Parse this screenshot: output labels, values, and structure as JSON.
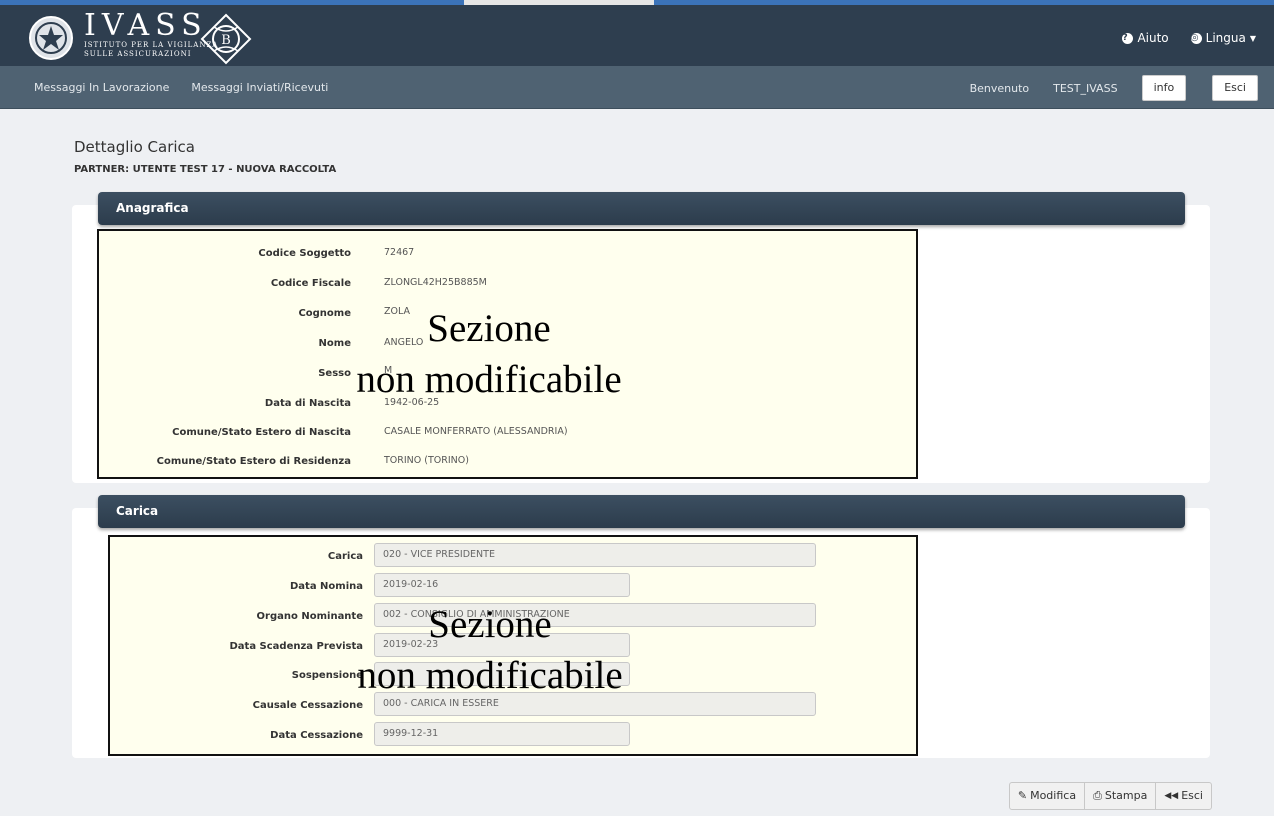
{
  "header": {
    "logo_title": "IVASS",
    "logo_line1": "ISTITUTO PER LA VIGILANZA",
    "logo_line2": "SULLE ASSICURAZIONI",
    "help_label": "Aiuto",
    "language_label": "Lingua"
  },
  "nav": {
    "items": [
      "Messaggi In Lavorazione",
      "Messaggi Inviati/Ricevuti"
    ],
    "welcome_label": "Benvenuto",
    "user": "TEST_IVASS",
    "info_label": "info",
    "exit_label": "Esci"
  },
  "page": {
    "title": "Dettaglio Carica",
    "subtitle": "PARTNER: UTENTE TEST 17 - NUOVA RACCOLTA"
  },
  "anagrafica": {
    "heading": "Anagrafica",
    "rows": [
      {
        "label": "Codice Soggetto",
        "value": "72467"
      },
      {
        "label": "Codice Fiscale",
        "value": "ZLONGL42H25B885M"
      },
      {
        "label": "Cognome",
        "value": "ZOLA"
      },
      {
        "label": "Nome",
        "value": "ANGELO"
      },
      {
        "label": "Sesso",
        "value": "M"
      },
      {
        "label": "Data di Nascita",
        "value": "1942-06-25"
      },
      {
        "label": "Comune/Stato Estero di Nascita",
        "value": "CASALE MONFERRATO (ALESSANDRIA)"
      },
      {
        "label": "Comune/Stato Estero di Residenza",
        "value": "TORINO (TORINO)"
      }
    ],
    "overlay_line1": "Sezione",
    "overlay_line2": "non modificabile"
  },
  "carica": {
    "heading": "Carica",
    "rows": [
      {
        "label": "Carica",
        "value": "020 - VICE PRESIDENTE"
      },
      {
        "label": "Data Nomina",
        "value": "2019-02-16"
      },
      {
        "label": "Organo Nominante",
        "value": "002 - CONSIGLIO DI AMMINISTRAZIONE"
      },
      {
        "label": "Data Scadenza Prevista",
        "value": "2019-02-23"
      },
      {
        "label": "Sospensione",
        "value": ""
      },
      {
        "label": "Causale Cessazione",
        "value": "000 - CARICA IN ESSERE"
      },
      {
        "label": "Data Cessazione",
        "value": "9999-12-31"
      }
    ],
    "overlay_line1": "Sezione",
    "overlay_line2": "non modificabile"
  },
  "actions": {
    "modify_label": "Modifica",
    "print_label": "Stampa",
    "exit_label": "Esci"
  }
}
